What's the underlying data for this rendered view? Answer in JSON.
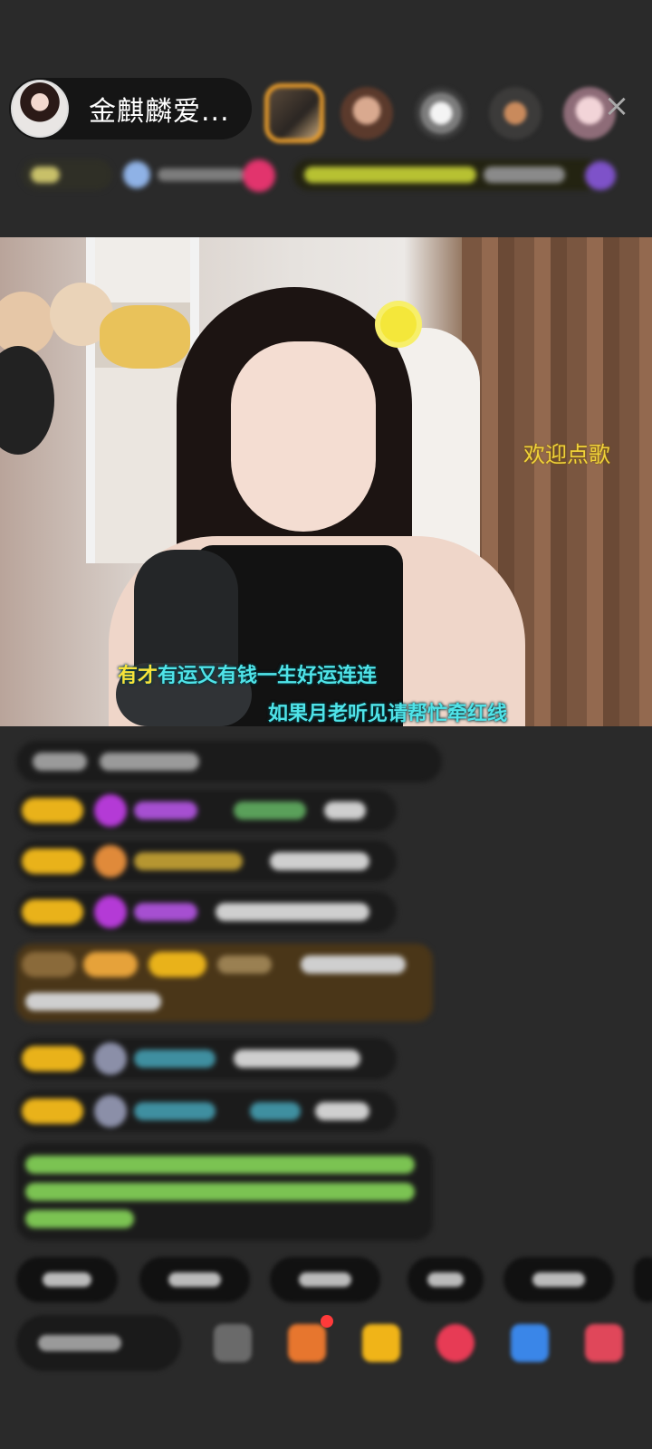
{
  "header": {
    "host_name": "金麒麟爱...",
    "close_icon": "close-icon",
    "viewer_avatars": [
      "viewer-avatar-1",
      "viewer-avatar-2",
      "viewer-avatar-3",
      "viewer-avatar-4",
      "viewer-avatar-5"
    ]
  },
  "video": {
    "song_request_hint": "欢迎点歌",
    "lyric_line_1_highlight": "有才",
    "lyric_line_1_rest": "有运又有钱一生好运连连",
    "lyric_line_2": "如果月老听见请帮忙牵红线"
  },
  "chat": {
    "messages": [
      "chat-message-1",
      "chat-message-2",
      "chat-message-3",
      "chat-message-4",
      "chat-message-5",
      "chat-message-6",
      "chat-message-7",
      "chat-message-8"
    ]
  },
  "bottom": {
    "quick_replies": [
      "quick-reply-1",
      "quick-reply-2",
      "quick-reply-3",
      "quick-reply-4",
      "quick-reply-5"
    ],
    "tool_icons": [
      "emoji-icon",
      "gift-box-icon",
      "gift-icon",
      "heart-icon",
      "game-icon",
      "more-icon"
    ]
  },
  "colors": {
    "background": "#2a2a2a",
    "badge_gold": "#e9b21a",
    "lyric_cyan": "#4fe3e8",
    "lyric_yellow": "#f7e33a",
    "hint_yellow": "#f0d23a"
  }
}
